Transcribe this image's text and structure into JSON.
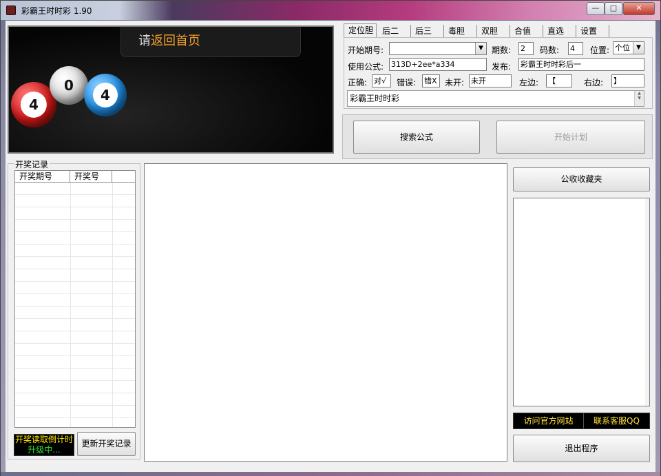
{
  "window": {
    "title": "彩霸王时时彩  1.90",
    "minimize_glyph": "—",
    "maximize_glyph": "□",
    "close_glyph": "✕"
  },
  "banner": {
    "prefix": "请",
    "link_text": "返回首页",
    "balls": [
      "4",
      "0",
      "4"
    ]
  },
  "tabs": [
    "定位胆",
    "后二",
    "后三",
    "毒胆",
    "双胆",
    "合值",
    "直选",
    "设置"
  ],
  "form": {
    "start_period_label": "开始期号:",
    "start_period_value": "",
    "periods_label": "期数:",
    "periods_value": "2",
    "codes_label": "码数:",
    "codes_value": "4",
    "position_label": "位置:",
    "position_value": "个位",
    "formula_label": "使用公式:",
    "formula_value": "313D+2ee*a334",
    "publish_label": "发布:",
    "publish_value": "彩霸王时时彩后一",
    "correct_label": "正确:",
    "correct_value": "对√",
    "wrong_label": "错误:",
    "wrong_value": "错X",
    "unopened_label": "未开:",
    "unopened_value": "未开",
    "left_label": "左边:",
    "left_value": "【",
    "right_label": "右边:",
    "right_value": "】",
    "memo_value": "彩霸王时时彩"
  },
  "actions": {
    "search_formula": "搜索公式",
    "start_plan": "开始计划"
  },
  "records": {
    "group_title": "开奖记录",
    "columns": [
      "开奖期号",
      "开奖号"
    ],
    "countdown_line1": "开奖读取倒计时",
    "countdown_line2": "升级中...",
    "update_button": "更新开奖记录"
  },
  "right_panel": {
    "favorites_button": "公收收藏夹",
    "visit_site": "访问官方网站",
    "contact_qq": "联系客服QQ",
    "exit_button": "退出程序"
  }
}
